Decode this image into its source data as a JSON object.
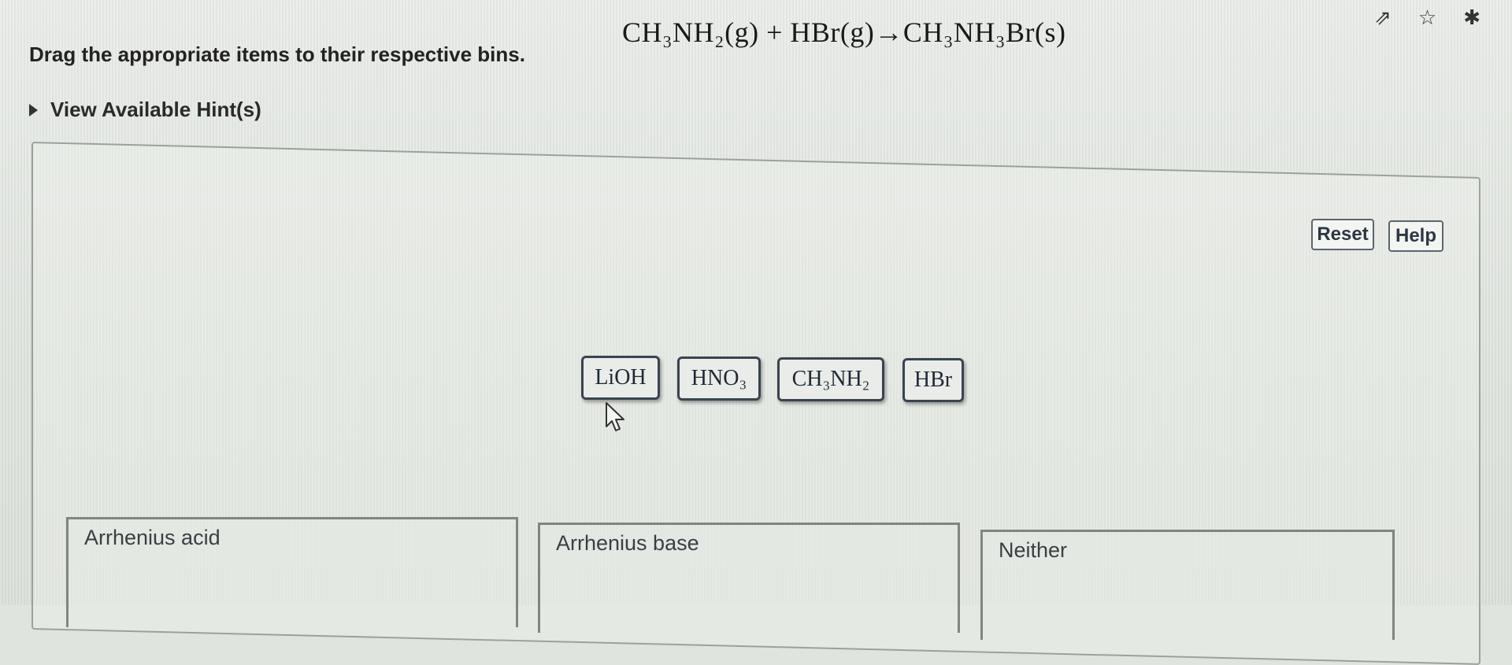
{
  "browser": {
    "icons": [
      "share-icon",
      "star-icon",
      "extension-icon"
    ]
  },
  "question": {
    "equation": "CH₃NH₂(g) + HBr(g)→CH₃NH₃Br(s)",
    "instruction": "Drag the appropriate items to their respective bins.",
    "hints_label": "View Available Hint(s)"
  },
  "controls": {
    "reset_label": "Reset",
    "help_label": "Help"
  },
  "items": [
    {
      "label": "LiOH"
    },
    {
      "label": "HNO₃"
    },
    {
      "label": "CH₃NH₂"
    },
    {
      "label": "HBr"
    }
  ],
  "bins": [
    {
      "label": "Arrhenius acid"
    },
    {
      "label": "Arrhenius base"
    },
    {
      "label": "Neither"
    }
  ],
  "colors": {
    "background": "#dfe4de",
    "item_border": "#3a4450",
    "button_text": "#2c3742"
  }
}
